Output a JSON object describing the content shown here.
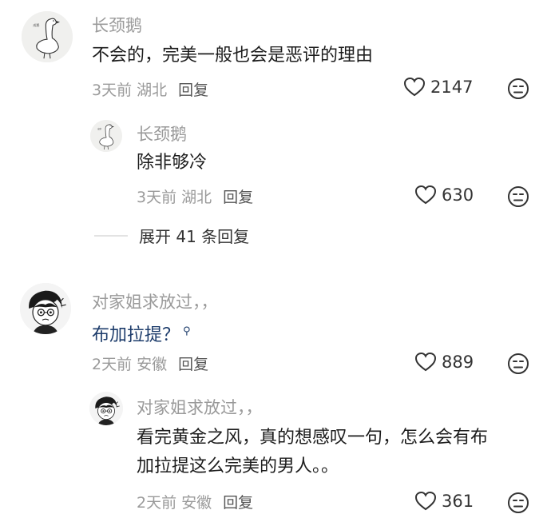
{
  "comments": [
    {
      "author": "长颈鹅",
      "text": "不会的，完美一般也会是恶评的理由",
      "time": "3天前",
      "location": "湖北",
      "reply_label": "回复",
      "likes": "2147",
      "avatar_icon": "goose-icon",
      "replies": [
        {
          "author": "长颈鹅",
          "text": "除非够冷",
          "time": "3天前",
          "location": "湖北",
          "reply_label": "回复",
          "likes": "630",
          "avatar_icon": "goose-icon"
        }
      ],
      "expand_label": "展开 41 条回复"
    },
    {
      "author": "对家姐求放过，，",
      "text": "布加拉提？",
      "time": "2天前",
      "location": "安徽",
      "reply_label": "回复",
      "likes": "889",
      "avatar_icon": "anime-boy-icon",
      "replies": [
        {
          "author": "对家姐求放过，，",
          "text_line1": "看完黄金之风，真的想感叹一句，怎么会有布",
          "text_line2": "加拉提这么完美的男人。。",
          "time": "2天前",
          "location": "安徽",
          "reply_label": "回复",
          "likes": "361",
          "avatar_icon": "anime-boy-icon"
        }
      ]
    }
  ],
  "colors": {
    "meta_gray": "#9a9a9a",
    "link_blue": "#1d3c6b"
  }
}
